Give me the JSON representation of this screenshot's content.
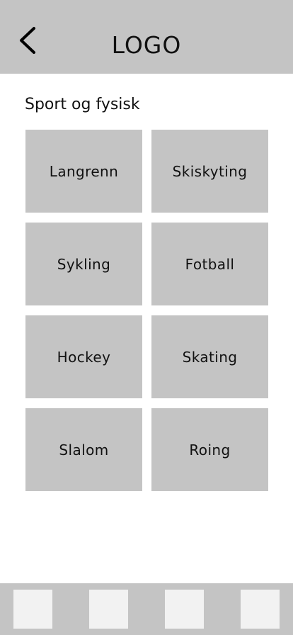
{
  "header": {
    "logo_text": "LOGO",
    "back_icon": "chevron-left-icon"
  },
  "section": {
    "title": "Sport og fysisk"
  },
  "tiles": [
    {
      "label": "Langrenn"
    },
    {
      "label": "Skiskyting"
    },
    {
      "label": "Sykling"
    },
    {
      "label": "Fotball"
    },
    {
      "label": "Hockey"
    },
    {
      "label": "Skating"
    },
    {
      "label": "Slalom"
    },
    {
      "label": "Roing"
    }
  ],
  "colors": {
    "bar": "#c4c4c4",
    "tile": "#c4c4c4",
    "nav_item": "#f2f2f2",
    "text": "#111111"
  }
}
